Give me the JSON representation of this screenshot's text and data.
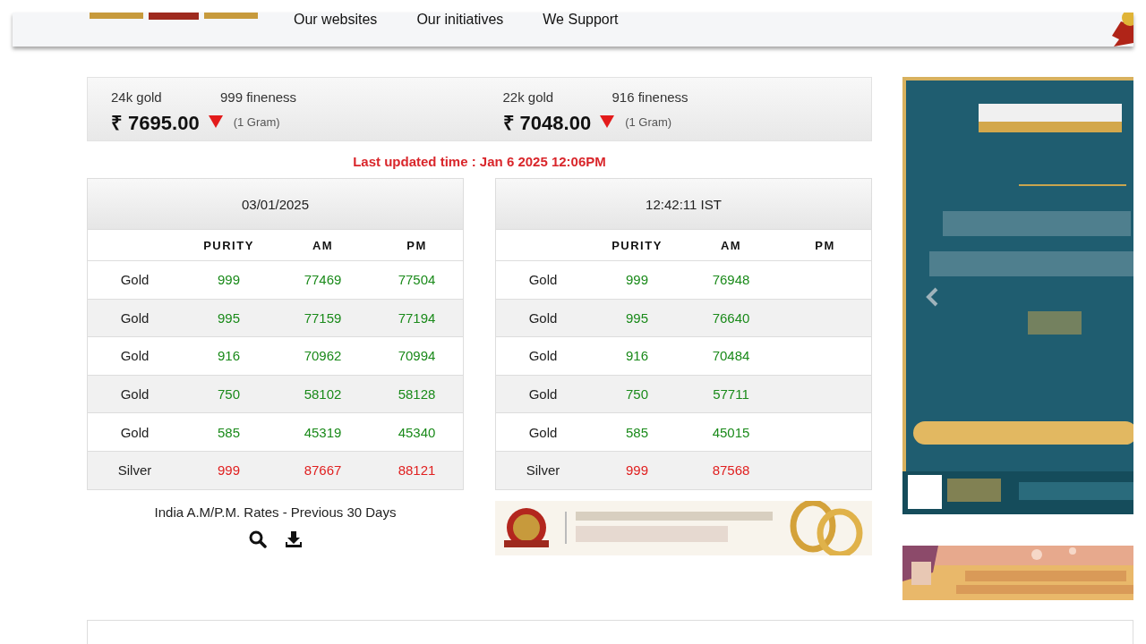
{
  "header": {
    "nav": [
      {
        "label": "Our websites"
      },
      {
        "label": "Our initiatives"
      },
      {
        "label": "We Support"
      }
    ]
  },
  "spot": [
    {
      "karat": "24k gold",
      "fineness": "999 fineness",
      "price": "₹ 7695.00",
      "falling": true,
      "unit": "(1 Gram)"
    },
    {
      "karat": "22k gold",
      "fineness": "916 fineness",
      "price": "₹ 7048.00",
      "falling": true,
      "unit": "(1 Gram)"
    }
  ],
  "last_updated": "Last updated time : Jan 6 2025 12:06PM",
  "tables": [
    {
      "title": "03/01/2025",
      "columns": [
        "PURITY",
        "AM",
        "PM"
      ],
      "rows": [
        {
          "metal": "Gold",
          "kind": "gold",
          "purity": "999",
          "am": "77469",
          "pm": "77504"
        },
        {
          "metal": "Gold",
          "kind": "gold",
          "purity": "995",
          "am": "77159",
          "pm": "77194"
        },
        {
          "metal": "Gold",
          "kind": "gold",
          "purity": "916",
          "am": "70962",
          "pm": "70994"
        },
        {
          "metal": "Gold",
          "kind": "gold",
          "purity": "750",
          "am": "58102",
          "pm": "58128"
        },
        {
          "metal": "Gold",
          "kind": "gold",
          "purity": "585",
          "am": "45319",
          "pm": "45340"
        },
        {
          "metal": "Silver",
          "kind": "silver",
          "purity": "999",
          "am": "87667",
          "pm": "88121"
        }
      ]
    },
    {
      "title": "12:42:11 IST",
      "columns": [
        "PURITY",
        "AM",
        "PM"
      ],
      "rows": [
        {
          "metal": "Gold",
          "kind": "gold",
          "purity": "999",
          "am": "76948"
        },
        {
          "metal": "Gold",
          "kind": "gold",
          "purity": "995",
          "am": "76640"
        },
        {
          "metal": "Gold",
          "kind": "gold",
          "purity": "916",
          "am": "70484"
        },
        {
          "metal": "Gold",
          "kind": "gold",
          "purity": "750",
          "am": "57711"
        },
        {
          "metal": "Gold",
          "kind": "gold",
          "purity": "585",
          "am": "45015"
        },
        {
          "metal": "Silver",
          "kind": "silver",
          "purity": "999",
          "am": "87568"
        }
      ]
    }
  ],
  "history": {
    "label": "India A.M/P.M. Rates - Previous 30 Days"
  }
}
